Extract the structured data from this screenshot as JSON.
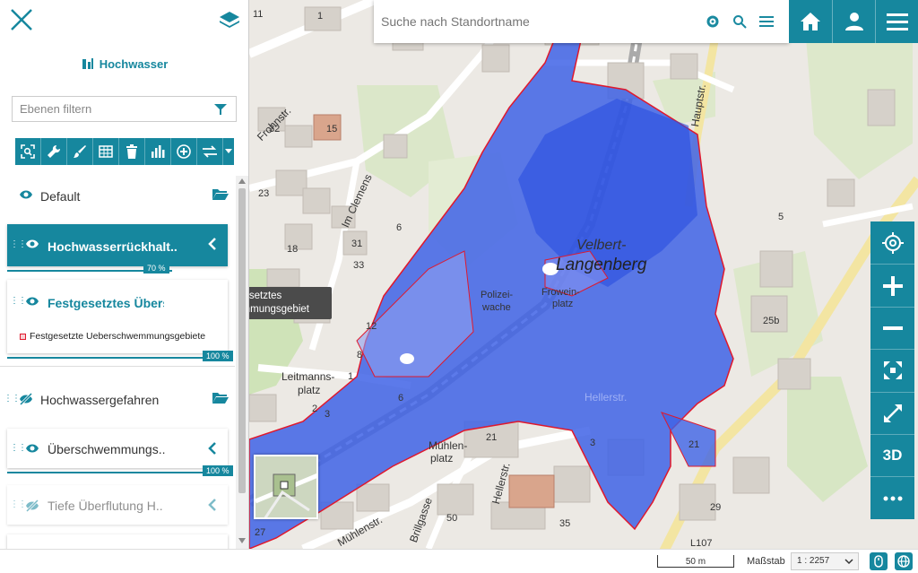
{
  "search": {
    "placeholder": "Suche nach Standortname"
  },
  "sidebar": {
    "title": "Hochwasser",
    "filter_placeholder": "Ebenen filtern",
    "toolbar_icons": [
      "zoom-to-icon",
      "wrench-icon",
      "brush-icon",
      "table-icon",
      "trash-icon",
      "chart-icon",
      "add-circle-icon",
      "swap-icon",
      "caret-down-icon"
    ],
    "groups": [
      {
        "label": "Default"
      },
      {
        "label": "Hochwassergefahren"
      }
    ],
    "layers": [
      {
        "label": "Hochwasserrückhalt..",
        "opacity": "70 %"
      },
      {
        "label": "Festgesetztes Überschwemmungsgebiet",
        "legend": "Festgesetzte Ueberschwemmungsgebiete",
        "opacity": "100 %"
      },
      {
        "label": "Überschwemmungs..",
        "opacity": "100 %"
      },
      {
        "label": "Tiefe Überflutung H.."
      }
    ]
  },
  "tooltip": {
    "line1": "Festgesetztes",
    "line2": "Überschwemmungsgebiet"
  },
  "map": {
    "labels": {
      "place1": "Velbert-",
      "place2": "Langenberg",
      "polizei1": "Polizei-",
      "polizei2": "wache",
      "frowein1": "Frowein-",
      "frowein2": "platz",
      "leitmanns1": "Leitmanns-",
      "leitmanns2": "platz",
      "muehlen1": "Mühlen-",
      "muehlen2": "platz",
      "frohnstr": "Frohnstr.",
      "imclemens": "Im Clemens",
      "hauptstr": "Hauptstr.",
      "hellerstr": "Hellerstr.",
      "muehlenstr": "Mühlenstr.",
      "brillgasse": "Brillgasse",
      "l107": "L107",
      "hellerstr_blue": "Hellerstr."
    },
    "housenumbers": [
      "11",
      "1",
      "32",
      "15",
      "23",
      "18",
      "31",
      "33",
      "25b",
      "5",
      "8",
      "21",
      "29",
      "27",
      "50",
      "35",
      "3",
      "1",
      "12",
      "3",
      "6",
      "2",
      "21",
      "6"
    ]
  },
  "mapTools": {
    "threeD": "3D"
  },
  "status": {
    "scale_distance": "50 m",
    "scale_label": "Maßstab",
    "scale_value": "1 : 2257"
  },
  "colors": {
    "accent": "#16879e",
    "flood": "#3b5de0",
    "flood_outline": "#e0182c"
  }
}
